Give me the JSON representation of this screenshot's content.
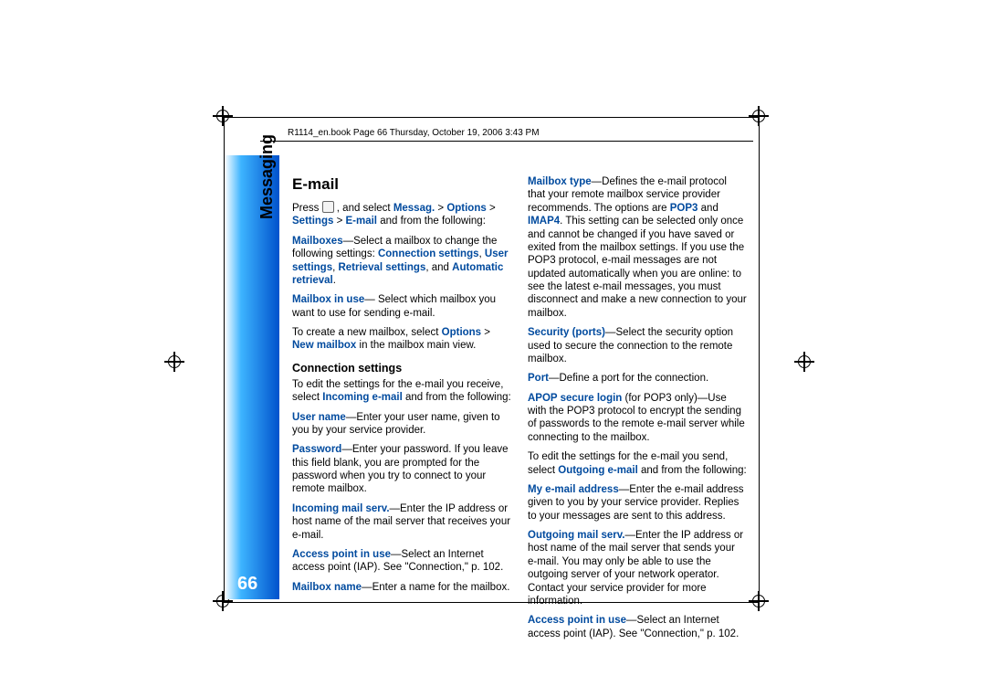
{
  "header": "R1114_en.book  Page 66  Thursday, October 19, 2006  3:43 PM",
  "side_label": "Messaging",
  "page_number": "66",
  "title": "E-mail",
  "col1": {
    "p1a": "Press ",
    "p1b": " , and select ",
    "nav1": "Messag.",
    "gt1": " > ",
    "nav2": "Options",
    "gt2": " > ",
    "nav3": "Settings",
    "gt3": " > ",
    "nav4": "E-mail",
    "p1c": " and from the following:",
    "mb": "Mailboxes",
    "mb_t": "—Select a mailbox to change the following settings: ",
    "cs": "Connection settings",
    "sep1": ", ",
    "us": "User settings",
    "sep2": ", ",
    "rs": "Retrieval settings",
    "sep3": ", and ",
    "ar": "Automatic retrieval",
    "dot1": ".",
    "miu": "Mailbox in use",
    "miu_t": "— Select which mailbox you want to use for sending e-mail.",
    "p3a": "To create a new mailbox, select ",
    "opt": "Options",
    "gt4": " > ",
    "nm": "New mailbox",
    "p3b": " in the mailbox main view.",
    "sub": "Connection settings",
    "p4a": "To edit the settings for the e-mail you receive, select ",
    "ie": "Incoming e-mail",
    "p4b": " and from the following:",
    "un": "User name",
    "un_t": "—Enter your user name, given to you by your service provider.",
    "pw": "Password",
    "pw_t": "—Enter your password. If you leave this field blank, you are prompted for the password when you try to connect to your remote mailbox.",
    "ims": "Incoming mail serv.",
    "ims_t": "—Enter the IP address or host name of the mail server that receives your e-mail.",
    "ap": "Access point in use",
    "ap_t": "—Select an Internet access point (IAP). See \"Connection,\" p. 102.",
    "mn": "Mailbox name",
    "mn_t": "—Enter a name for the mailbox."
  },
  "col2": {
    "mt": "Mailbox type",
    "mt_t1": "—Defines the e-mail protocol that your remote mailbox service provider recommends. The options are ",
    "pop3": "POP3",
    "and": " and ",
    "imap4": "IMAP4",
    "mt_t2": ". This setting can be selected only once and cannot be changed if you have saved or exited from the mailbox settings. If you use the POP3 protocol, e-mail messages are not updated automatically when you are online: to see the latest e-mail messages, you must disconnect and make a new connection to your mailbox.",
    "sp": "Security (ports)",
    "sp_t": "—Select the security option used to secure the connection to the remote mailbox.",
    "pt": "Port",
    "pt_t": "—Define a port for the connection.",
    "asl": "APOP secure login",
    "asl_t": " (for POP3 only)—Use with the POP3 protocol to encrypt the sending of passwords to the remote e-mail server while connecting to the mailbox.",
    "p5a": "To edit the settings for the e-mail you send, select ",
    "oe": "Outgoing e-mail",
    "p5b": " and from the following:",
    "mea": "My e-mail address",
    "mea_t": "—Enter the e-mail address given to you by your service provider. Replies to your messages are sent to this address.",
    "oms": "Outgoing mail serv.",
    "oms_t": "—Enter the IP address or host name of the mail server that sends your e-mail. You may only be able to use the outgoing server of your network operator. Contact your service provider for more information.",
    "ap2": "Access point in use",
    "ap2_t": "—Select an Internet access point (IAP). See \"Connection,\" p. 102."
  }
}
